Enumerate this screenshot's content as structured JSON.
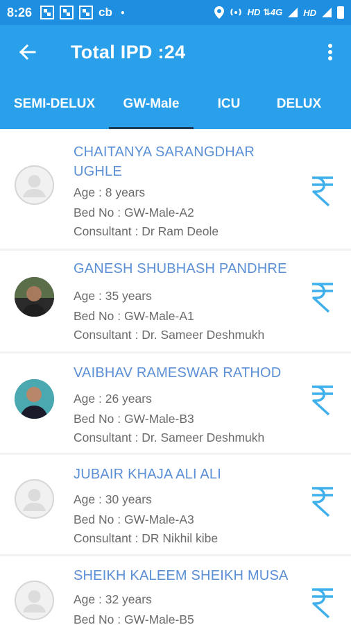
{
  "status_bar": {
    "time": "8:26",
    "app_short": "cb",
    "right_text": "HD ⇅4G",
    "right_text2": "HD"
  },
  "header": {
    "title": "Total IPD :24"
  },
  "tabs": [
    {
      "label": "SEMI-DELUX",
      "active": false
    },
    {
      "label": "GW-Male",
      "active": true
    },
    {
      "label": "ICU",
      "active": false
    },
    {
      "label": "DELUX",
      "active": false
    }
  ],
  "patients": [
    {
      "name_line1": "CHAITANYA SARANGDHAR",
      "name_line2": "UGHLE",
      "age": "Age : 8 years",
      "bed": "Bed No : GW-Male-A2",
      "consultant": "Consultant : Dr Ram Deole",
      "avatar": "placeholder"
    },
    {
      "name_line1": "GANESH  SHUBHASH PANDHRE",
      "name_line2": "",
      "age": "Age : 35 years",
      "bed": "Bed No : GW-Male-A1",
      "consultant": "Consultant : Dr. Sameer Deshmukh",
      "avatar": "photo"
    },
    {
      "name_line1": "VAIBHAV RAMESWAR RATHOD",
      "name_line2": "",
      "age": "Age : 26 years",
      "bed": "Bed No : GW-Male-B3",
      "consultant": "Consultant : Dr. Sameer Deshmukh",
      "avatar": "photo"
    },
    {
      "name_line1": "JUBAIR  KHAJA ALI ALI",
      "name_line2": "",
      "age": "Age : 30 years",
      "bed": "Bed No : GW-Male-A3",
      "consultant": "Consultant : DR Nikhil kibe",
      "avatar": "placeholder"
    },
    {
      "name_line1": "SHEIKH KALEEM SHEIKH MUSA",
      "name_line2": "",
      "age": "Age : 32 years",
      "bed": "Bed No : GW-Male-B5",
      "consultant": "",
      "avatar": "placeholder"
    }
  ],
  "colors": {
    "status_bar": "#1e8fe0",
    "app_bar": "#2aa0ea",
    "name_text": "#5b8fd6",
    "detail_text": "#6b6b6b",
    "rupee_icon": "#3fb0ec"
  },
  "icons": {
    "back": "arrow-left-icon",
    "more": "more-vert-icon",
    "bill": "rupee-icon",
    "avatar_placeholder": "person-icon"
  }
}
